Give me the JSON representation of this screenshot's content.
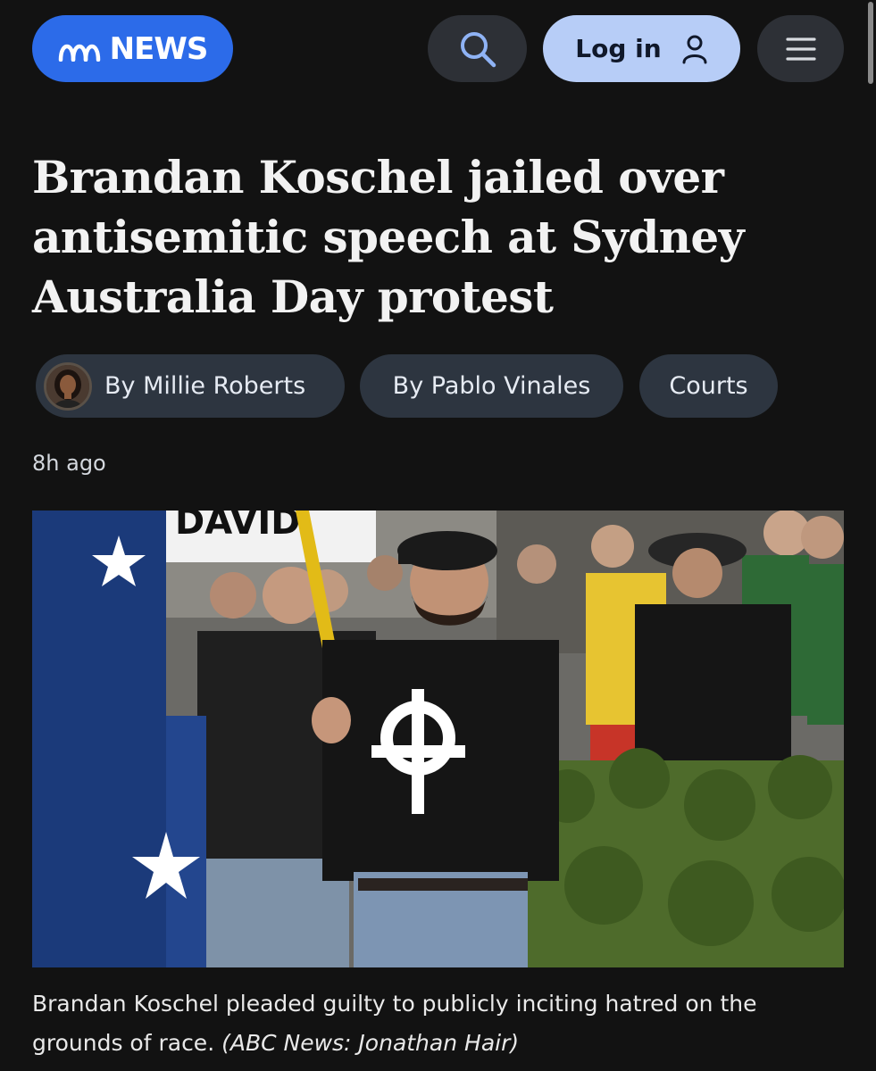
{
  "header": {
    "logo_text": "NEWS",
    "login_label": "Log in",
    "icons": {
      "search": "search-icon",
      "user": "user-icon",
      "menu": "hamburger-menu-icon"
    },
    "colors": {
      "logo_bg": "#2c6be9",
      "login_bg": "#b7cdf7",
      "icon_button_bg": "#2d3036"
    }
  },
  "article": {
    "headline": "Brandan Koschel jailed over antisemitic speech at Sydney Australia Day protest",
    "byline_pills": [
      {
        "label": "By Millie Roberts"
      },
      {
        "label": "By Pablo Vinales"
      }
    ],
    "topic_pill": "Courts",
    "timestamp": "8h ago",
    "caption": "Brandan Koschel pleaded guilty to publicly inciting hatred on the grounds of race.",
    "credit": "(ABC News: Jonathan Hair)",
    "photo_banner_text": "DAVID"
  }
}
